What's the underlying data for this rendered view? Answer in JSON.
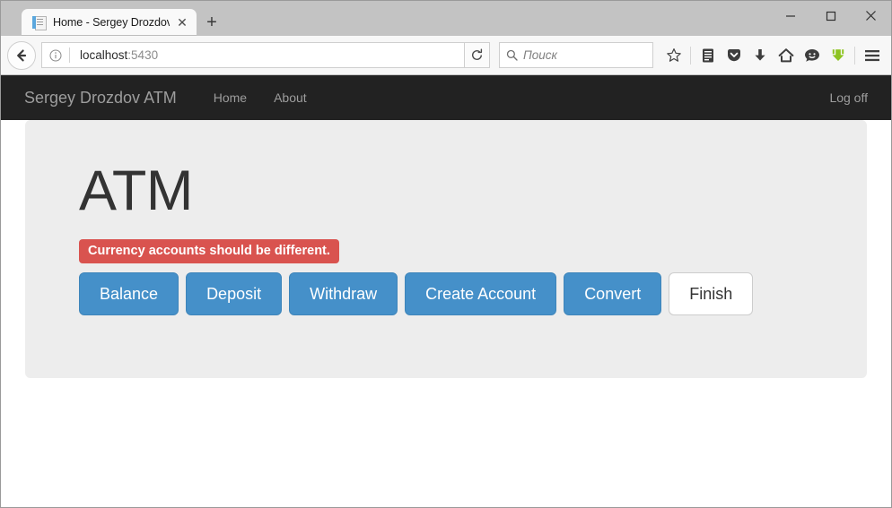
{
  "browser": {
    "tab": {
      "title": "Home - Sergey Drozdov A...",
      "favicon": "page-icon",
      "close_label": "✕"
    },
    "new_tab_label": "+",
    "window_controls": {
      "minimize": "minimize-icon",
      "maximize": "maximize-icon",
      "close": "close-icon"
    },
    "back_label": "back-arrow-icon",
    "url": {
      "host": "localhost",
      "port": ":5430"
    },
    "identity_icon": "info-icon",
    "reload_label": "reload-icon",
    "search": {
      "placeholder": "Поиск",
      "icon": "search-icon"
    },
    "toolbar_icons": [
      "bookmark-star-icon",
      "reader-list-icon",
      "pocket-icon",
      "downloads-icon",
      "home-icon",
      "feedback-smiley-icon",
      "downthemall-icon",
      "hamburger-menu-icon"
    ]
  },
  "site": {
    "brand": "Sergey Drozdov ATM",
    "nav": [
      {
        "label": "Home"
      },
      {
        "label": "About"
      }
    ],
    "nav_right": [
      {
        "label": "Log off"
      }
    ]
  },
  "main": {
    "title": "ATM",
    "alert": {
      "text": "Currency accounts should be different.",
      "color": "#d9534f"
    },
    "buttons": [
      {
        "label": "Balance",
        "style": "primary"
      },
      {
        "label": "Deposit",
        "style": "primary"
      },
      {
        "label": "Withdraw",
        "style": "primary"
      },
      {
        "label": "Create Account",
        "style": "primary"
      },
      {
        "label": "Convert",
        "style": "primary"
      },
      {
        "label": "Finish",
        "style": "default"
      }
    ]
  },
  "colors": {
    "navbar_bg": "#222222",
    "jumbotron_bg": "#ededed",
    "primary": "#4590c9",
    "danger": "#d9534f"
  }
}
